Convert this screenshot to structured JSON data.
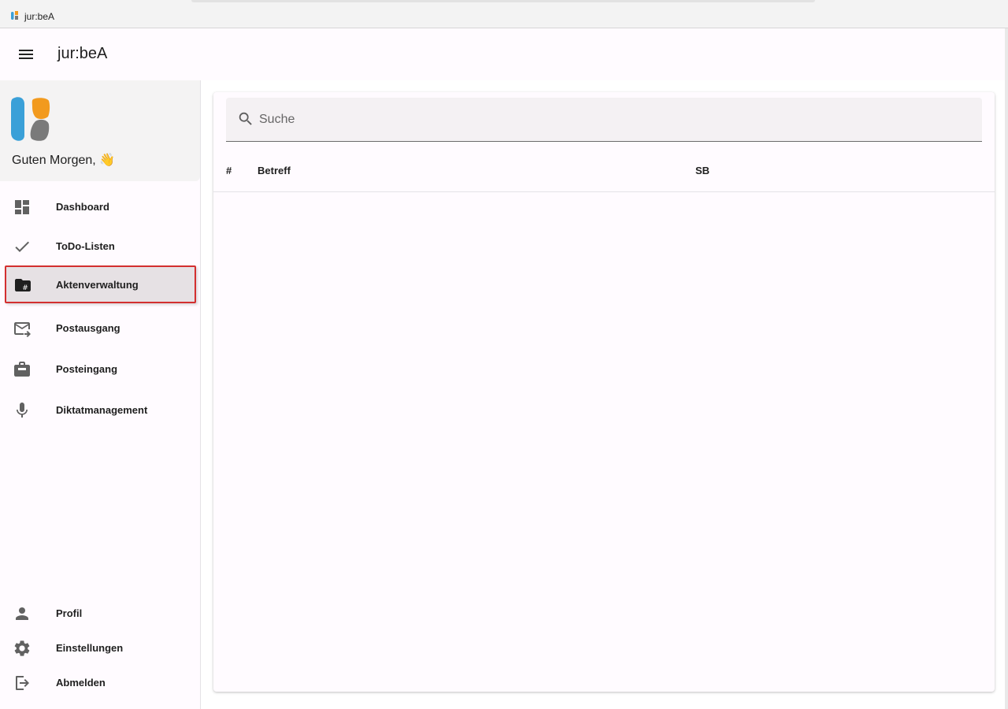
{
  "window": {
    "title": "jur:beA"
  },
  "appbar": {
    "title": "jur:beA",
    "menu_icon": "hamburger-menu-icon"
  },
  "sidebar": {
    "greeting": "Guten Morgen, 👋",
    "nav_items": [
      {
        "label": "Dashboard",
        "icon": "dashboard-icon"
      },
      {
        "label": "ToDo-Listen",
        "icon": "check-icon"
      },
      {
        "label": "Aktenverwaltung",
        "icon": "folder-hash-icon",
        "active": true
      },
      {
        "label": "Postausgang",
        "icon": "mail-outgoing-icon"
      },
      {
        "label": "Posteingang",
        "icon": "inbox-icon"
      },
      {
        "label": "Diktatmanagement",
        "icon": "microphone-icon"
      }
    ],
    "bottom_items": [
      {
        "label": "Profil",
        "icon": "person-icon"
      },
      {
        "label": "Einstellungen",
        "icon": "gear-icon"
      },
      {
        "label": "Abmelden",
        "icon": "logout-icon"
      }
    ]
  },
  "main": {
    "search": {
      "placeholder": "Suche",
      "value": ""
    },
    "table": {
      "columns": [
        "#",
        "Betreff",
        "SB"
      ],
      "rows": []
    }
  },
  "colors": {
    "logo_blue": "#3aa0d8",
    "logo_orange": "#f29a1e",
    "logo_gray": "#7a7a7a",
    "highlight_red": "#d32f2f"
  }
}
